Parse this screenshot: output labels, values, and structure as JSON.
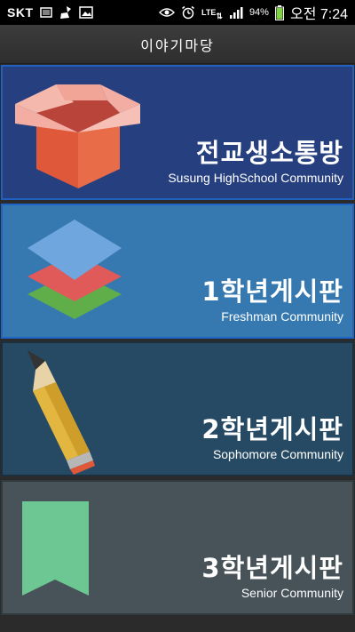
{
  "status_bar": {
    "carrier": "SKT",
    "network": "LTE",
    "battery_percent": "94%",
    "time": "오전 7:24",
    "icons": [
      "sim-card-icon",
      "cleanup-icon",
      "image-icon",
      "eye-icon",
      "alarm-icon",
      "lte-icon",
      "signal-icon",
      "battery-icon"
    ]
  },
  "header": {
    "title": "이야기마당"
  },
  "boards": [
    {
      "title": "전교생소통방",
      "subtitle": "Susung HighSchool Community",
      "icon": "open-box-icon",
      "color": "#263f7f"
    },
    {
      "title": "1학년게시판",
      "subtitle": "Freshman Community",
      "icon": "layers-icon",
      "color": "#3579b0"
    },
    {
      "title": "2학년게시판",
      "subtitle": "Sophomore Community",
      "icon": "pencil-icon",
      "color": "#264a63"
    },
    {
      "title": "3학년게시판",
      "subtitle": "Senior Community",
      "icon": "bookmark-icon",
      "color": "#475358"
    }
  ]
}
